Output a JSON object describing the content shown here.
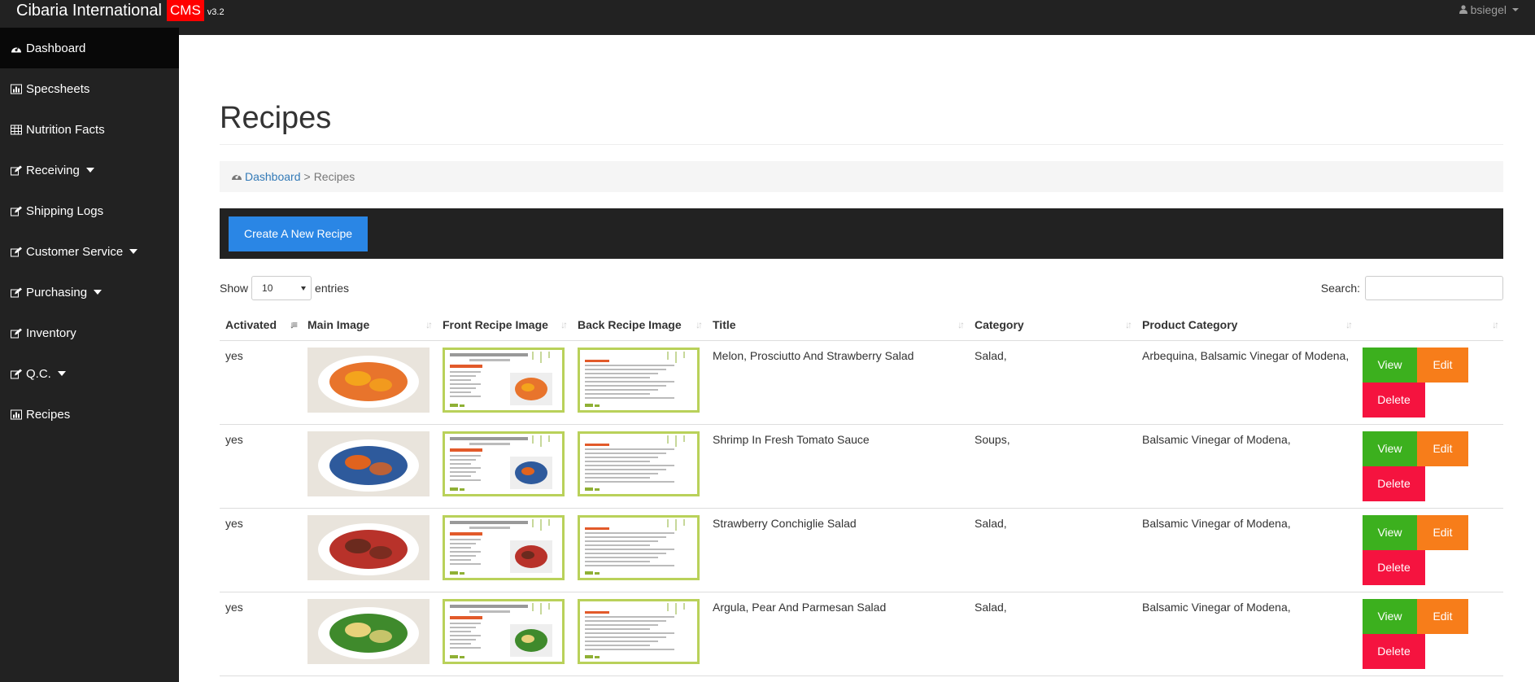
{
  "topbar": {
    "brand_name": "Cibaria International",
    "brand_badge": "CMS",
    "brand_version": "v3.2",
    "user_name": "bsiegel"
  },
  "sidebar": {
    "items": [
      {
        "label": "Dashboard",
        "icon": "dashboard-icon",
        "active": true,
        "dropdown": false
      },
      {
        "label": "Specsheets",
        "icon": "bar-chart-icon",
        "dropdown": false
      },
      {
        "label": "Nutrition Facts",
        "icon": "table-icon",
        "dropdown": false
      },
      {
        "label": "Receiving",
        "icon": "edit-icon",
        "dropdown": true
      },
      {
        "label": "Shipping Logs",
        "icon": "edit-icon",
        "dropdown": false
      },
      {
        "label": "Customer Service",
        "icon": "edit-icon",
        "dropdown": true
      },
      {
        "label": "Purchasing",
        "icon": "edit-icon",
        "dropdown": true
      },
      {
        "label": "Inventory",
        "icon": "edit-icon",
        "dropdown": false
      },
      {
        "label": "Q.C.",
        "icon": "edit-icon",
        "dropdown": true
      },
      {
        "label": "Recipes",
        "icon": "bar-chart-icon",
        "dropdown": false
      }
    ]
  },
  "main": {
    "title": "Recipes",
    "breadcrumb": {
      "link": "Dashboard",
      "separator": ">",
      "current": "Recipes"
    },
    "create_button": "Create A New Recipe",
    "show_label": "Show",
    "entries_value": "10",
    "entries_label": "entries",
    "search_label": "Search:",
    "search_value": ""
  },
  "table": {
    "columns": [
      "Activated",
      "Main Image",
      "Front Recipe Image",
      "Back Recipe Image",
      "Title",
      "Category",
      "Product Category",
      ""
    ],
    "rows": [
      {
        "activated": "yes",
        "title": "Melon, Prosciutto And Strawberry Salad",
        "category": "Salad,",
        "product_category": "Arbequina, Balsamic Vinegar of Modena,",
        "main_color": "#e8742c",
        "accent_color": "#f4a41c"
      },
      {
        "activated": "yes",
        "title": "Shrimp In Fresh Tomato Sauce",
        "category": "Soups,",
        "product_category": "Balsamic Vinegar of Modena,",
        "main_color": "#2e5a9c",
        "accent_color": "#e0631e"
      },
      {
        "activated": "yes",
        "title": "Strawberry Conchiglie Salad",
        "category": "Salad,",
        "product_category": "Balsamic Vinegar of Modena,",
        "main_color": "#b8322a",
        "accent_color": "#6b2a1e"
      },
      {
        "activated": "yes",
        "title": "Argula, Pear And Parmesan Salad",
        "category": "Salad,",
        "product_category": "Balsamic Vinegar of Modena,",
        "main_color": "#3f8a2c",
        "accent_color": "#e8d27a"
      }
    ],
    "view_label": "View",
    "edit_label": "Edit",
    "delete_label": "Delete"
  }
}
